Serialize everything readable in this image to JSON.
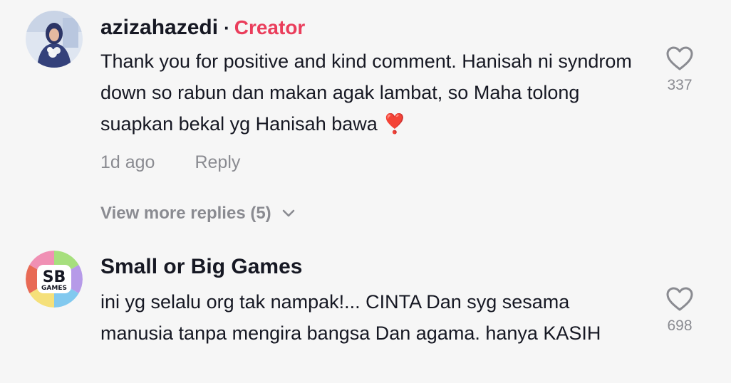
{
  "comments": [
    {
      "username": "azizahazedi",
      "separator": "·",
      "badge": "Creator",
      "badge_color": "#ea3d5b",
      "text": "Thank you for positive and kind comment. Hanisah ni syndrom down so rabun dan makan agak lambat, so Maha tolong suapkan bekal yg Hanisah bawa",
      "emoji": "❣️",
      "time": "1d ago",
      "reply_label": "Reply",
      "view_more": "View more replies (5)",
      "like_count": "337",
      "avatar_icon": "user-photo-avatar"
    },
    {
      "username": "Small or Big Games",
      "text": "ini yg selalu org tak nampak!... CINTA Dan syg sesama manusia tanpa mengira bangsa Dan agama. hanya KASIH",
      "like_count": "698",
      "avatar_icon": "sb-games-logo",
      "avatar_logo": {
        "line1": "SB",
        "line2": "GAMES"
      }
    }
  ]
}
